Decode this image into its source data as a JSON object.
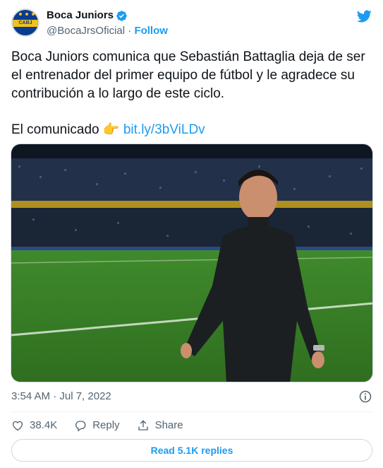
{
  "account": {
    "display_name": "Boca Juniors",
    "handle": "@BocaJrsOficial",
    "separator": "·",
    "follow_label": "Follow",
    "avatar_text": "CABJ"
  },
  "tweet": {
    "body": "Boca Juniors comunica que Sebastián Battaglia deja de ser el entrenador del primer equipo de fútbol y le agradece su contribución a lo largo de este ciclo.",
    "line2_text": "El comunicado",
    "line2_emoji": "👉",
    "link": "bit.ly/3bViLDv",
    "timestamp": "3:54 AM · Jul 7, 2022"
  },
  "actions": {
    "likes": "38.4K",
    "reply_label": "Reply",
    "share_label": "Share"
  },
  "replies_button": "Read 5.1K replies",
  "colors": {
    "accent": "#1d9bf0",
    "muted": "#536471",
    "text": "#0f1419",
    "boca_blue": "#0b3b8c",
    "boca_gold": "#f2c21a"
  },
  "icons": {
    "verified": "verified-badge-icon",
    "bird": "twitter-bird-icon",
    "info": "info-icon",
    "like": "heart-icon",
    "reply": "reply-bubble-icon",
    "share": "share-upload-icon"
  }
}
